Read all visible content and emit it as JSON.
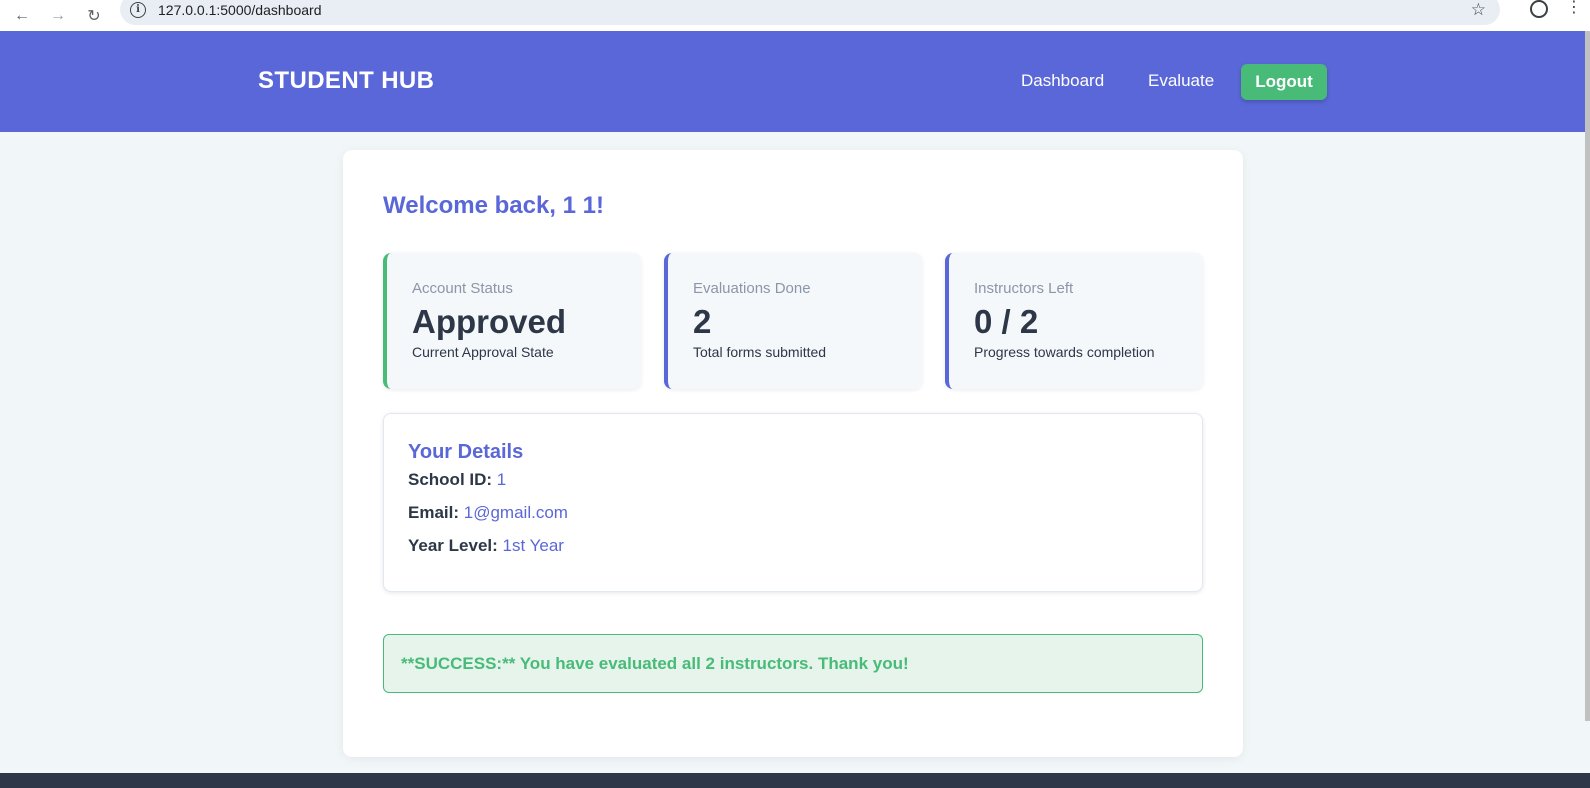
{
  "browser": {
    "url": "127.0.0.1:5000/dashboard",
    "icons": [
      "back-icon",
      "forward-icon",
      "reload-icon",
      "info-icon",
      "star-icon",
      "profile-icon",
      "menu-icon"
    ]
  },
  "header": {
    "brand": "STUDENT HUB",
    "nav": {
      "dashboard": "Dashboard",
      "evaluate": "Evaluate"
    },
    "logout_label": "Logout",
    "colors": {
      "primary": "#5a67d8",
      "success": "#48bb78"
    }
  },
  "main": {
    "welcome": "Welcome back, 1 1!",
    "stats": [
      {
        "label": "Account Status",
        "value": "Approved",
        "sub": "Current Approval State",
        "accent": "#48bb78"
      },
      {
        "label": "Evaluations Done",
        "value": "2",
        "sub": "Total forms submitted",
        "accent": "#5a67d8"
      },
      {
        "label": "Instructors Left",
        "value": "0 / 2",
        "sub": "Progress towards completion",
        "accent": "#5a67d8"
      }
    ],
    "details": {
      "title": "Your Details",
      "school_id_label": "School ID:",
      "school_id": "1",
      "email_label": "Email:",
      "email": "1@gmail.com",
      "year_label": "Year Level:",
      "year": "1st Year"
    },
    "success_message": "**SUCCESS:** You have evaluated all 2 instructors. Thank you!"
  }
}
